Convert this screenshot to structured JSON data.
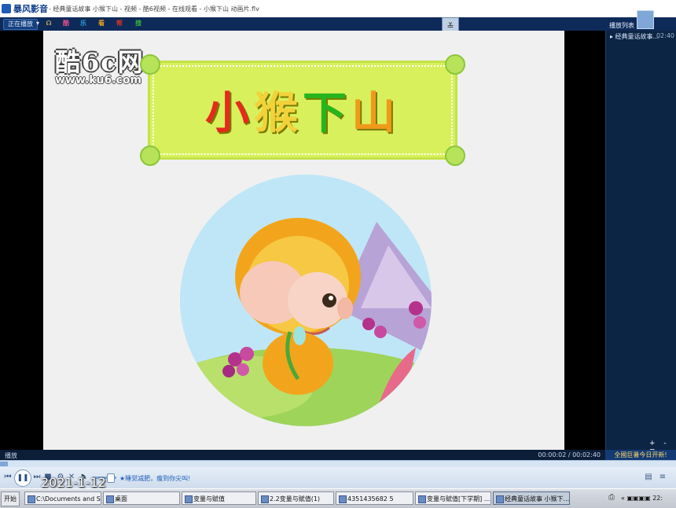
{
  "window": {
    "app_name": "暴风影音",
    "title_text": "- 经典童话故事 小猴下山 - 视频 - 酷6视频 - 在线观看 - 小猴下山 动画片.flv"
  },
  "toolbar": {
    "now_playing_label": "正在播放",
    "icon_labels": [
      "酷",
      "乐",
      "看",
      "帮",
      "搜"
    ],
    "icon_colors": [
      "#e74d8a",
      "#29a3e0",
      "#e6a21b",
      "#d9322d",
      "#35b23e"
    ],
    "playlist_label": "播放列表"
  },
  "video": {
    "watermark_brand": "酷6c网",
    "watermark_url": "www.ku6.com",
    "banner_chars": [
      "小",
      "猴",
      "下",
      "山"
    ]
  },
  "playlist": {
    "items": [
      {
        "label": "▸ 经典童话故事...",
        "duration": "02:40"
      }
    ],
    "controls": "+ - ≡",
    "footer": "全國巨暑今日开新!"
  },
  "status": {
    "state": "播放",
    "time": "00:00:02 / 00:02:40"
  },
  "playback": {
    "progress": 0.012,
    "volume": 0.55,
    "tip": "★睡觉减肥，瘦到你尖叫!",
    "date_overlay": "2021-1-12"
  },
  "taskbar": {
    "start_label": "开始",
    "tasks": [
      "C:\\Documents and Se...",
      "桌面",
      "变量与赋值",
      "2.2变量与赋值(1)",
      "4351435682 5",
      "变量与赋值[下学期] ...",
      "经典童话故事 小猴下..."
    ],
    "tray_time": "22:"
  }
}
